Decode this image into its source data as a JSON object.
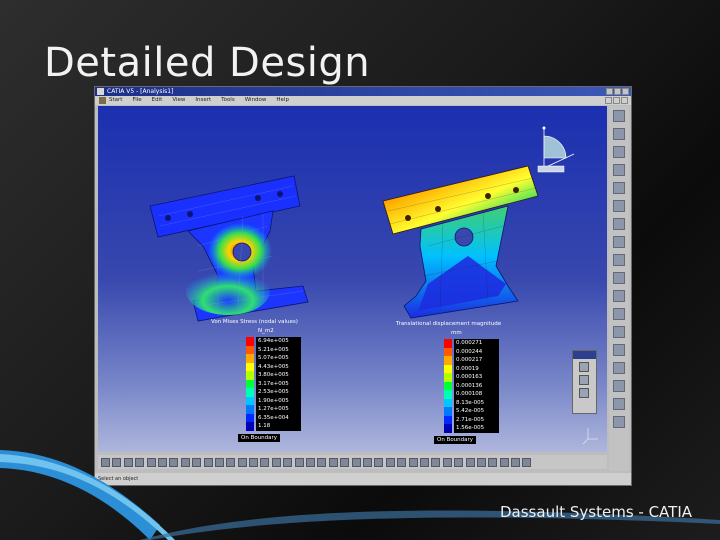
{
  "slide": {
    "title": "Detailed Design",
    "footer": "Dassault Systems - CATIA"
  },
  "window": {
    "title": "CATIA V5 - [Analysis1]"
  },
  "menu": [
    "Start",
    "File",
    "Edit",
    "View",
    "Insert",
    "Tools",
    "Window",
    "Help"
  ],
  "status_bar": "Select an object",
  "left_legend": {
    "title": "Von Mises Stress (nodal values)",
    "unit": "N_m2",
    "values": [
      "6.94e+005",
      "5.21e+005",
      "5.07e+005",
      "4.43e+005",
      "3.80e+005",
      "3.17e+005",
      "2.53e+005",
      "1.90e+005",
      "1.27e+005",
      "6.35e+004",
      "1.18"
    ],
    "footer": "On Boundary"
  },
  "right_legend": {
    "title": "Translational displacement magnitude",
    "unit": "mm",
    "values": [
      "0.000271",
      "0.000244",
      "0.000217",
      "0.00019",
      "0.000163",
      "0.000136",
      "0.000108",
      "8.13e-005",
      "5.42e-005",
      "2.71e-005",
      "1.56e-005"
    ],
    "footer": "On Boundary"
  },
  "legend_colors": [
    "#ff0000",
    "#ff5a00",
    "#ffaa00",
    "#ffff00",
    "#b4ff00",
    "#00ff3c",
    "#00ffb4",
    "#00c8ff",
    "#0078ff",
    "#0028ff",
    "#0000b4"
  ],
  "icons": {
    "compass": "compass-icon",
    "axis": "axis-triad-icon",
    "right_toolbar_count": 18,
    "bottom_toolbar_count": 38
  }
}
